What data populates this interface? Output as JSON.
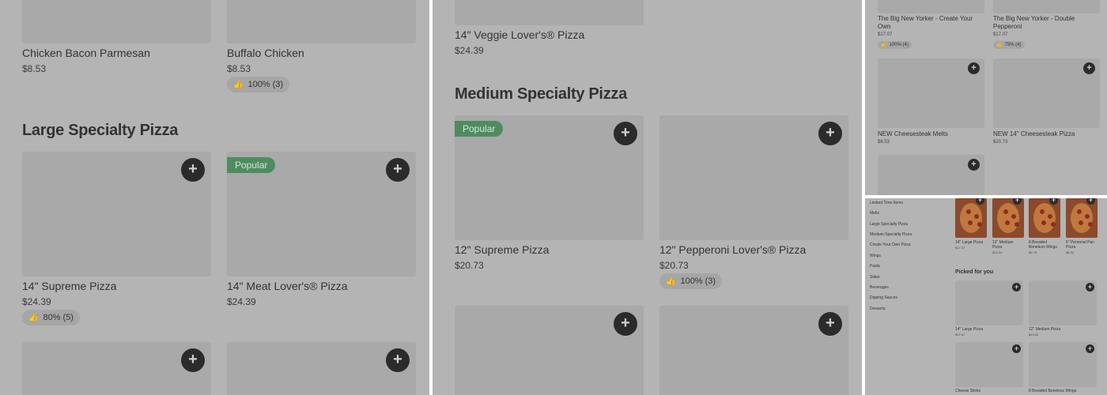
{
  "panel1": {
    "items_top": [
      {
        "name": "Chicken Bacon Parmesan",
        "price": "$8.53"
      },
      {
        "name": "Buffalo Chicken",
        "price": "$8.53",
        "rating": "100% (3)"
      }
    ],
    "section_title": "Large Specialty Pizza",
    "items": [
      {
        "name": "14\" Supreme Pizza",
        "price": "$24.39",
        "rating": "80% (5)"
      },
      {
        "name": "14\" Meat Lover's® Pizza",
        "price": "$24.39",
        "badge": "Popular"
      }
    ]
  },
  "panel2": {
    "top_item": {
      "name": "14\" Veggie Lover's® Pizza",
      "price": "$24.39"
    },
    "section_title": "Medium Specialty Pizza",
    "items": [
      {
        "name": "12\" Supreme Pizza",
        "price": "$20.73",
        "badge": "Popular"
      },
      {
        "name": "12\" Pepperoni Lover's® Pizza",
        "price": "$20.73",
        "rating": "100% (3)"
      }
    ]
  },
  "panel3": {
    "items": [
      {
        "name": "The Big New Yorker - Create Your Own",
        "price": "$17.07",
        "rating": "100% (4)"
      },
      {
        "name": "The Big New Yorker - Double Pepperoni",
        "price": "$17.07",
        "rating": "75% (4)"
      },
      {
        "name": "NEW Cheesesteak Melts",
        "price": "$8.53"
      },
      {
        "name": "NEW 14\" Cheesesteak Pizza",
        "price": "$20.73"
      }
    ]
  },
  "panel4": {
    "categories": [
      "Limited Time Items",
      "Melts",
      "Large Specialty Pizza",
      "Medium Specialty Pizza",
      "Create Your Own Pizza",
      "Wings",
      "Pasta",
      "Sides",
      "Beverages",
      "Dipping Sauces",
      "Desserts"
    ],
    "featured": [
      {
        "name": "14\" Large Pizza",
        "price": "$17.07"
      },
      {
        "name": "12\" Medium Pizza",
        "price": "$13.24"
      },
      {
        "name": "8 Breaded Boneless Wings",
        "price": "$9.75"
      },
      {
        "name": "6\" Personal Pan Pizza",
        "price": "$6.32"
      }
    ],
    "picked_title": "Picked for you",
    "picked": [
      {
        "name": "14\" Large Pizza",
        "price": "$17.07"
      },
      {
        "name": "12\" Medium Pizza",
        "price": "$13.24"
      },
      {
        "name": "Cheese Sticks",
        "price": ""
      },
      {
        "name": "8 Breaded Boneless Wings",
        "price": ""
      }
    ]
  },
  "icons": {
    "add": "plus-icon",
    "thumb": "thumbs-up-icon"
  },
  "colors": {
    "popular_badge": "#4e8c60",
    "add_button": "#2b2b2b",
    "overlay": "#b4b4b4"
  },
  "glyphs": {
    "plus": "+",
    "thumb": "👍"
  }
}
